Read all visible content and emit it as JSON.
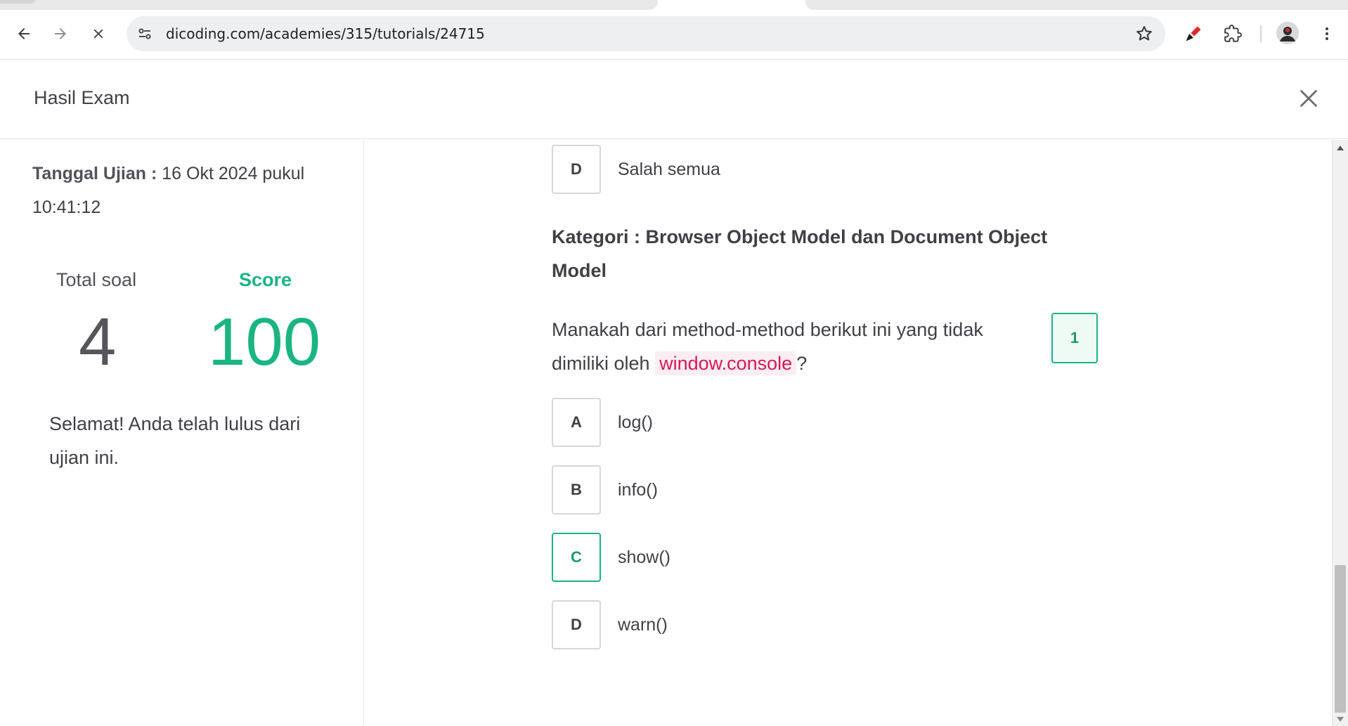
{
  "browser": {
    "url": "dicoding.com/academies/315/tutorials/24715"
  },
  "header": {
    "title": "Hasil Exam"
  },
  "summary": {
    "date_label": "Tanggal Ujian :",
    "date_value": "16 Okt 2024 pukul 10:41:12",
    "total_label": "Total soal",
    "total_value": "4",
    "score_label": "Score",
    "score_value": "100",
    "message": "Selamat! Anda telah lulus dari ujian ini."
  },
  "previous_question": {
    "option": {
      "letter": "D",
      "text": "Salah semua"
    }
  },
  "question": {
    "category": "Kategori : Browser Object Model dan Document Object Model",
    "text_before": "Manakah dari method-method berikut ini yang tidak dimiliki oleh",
    "code": "window.console",
    "text_after": "?",
    "number": "1",
    "options": [
      {
        "letter": "A",
        "text": "log()"
      },
      {
        "letter": "B",
        "text": "info()"
      },
      {
        "letter": "C",
        "text": "show()"
      },
      {
        "letter": "D",
        "text": "warn()"
      }
    ],
    "correct_color": "#1ab580"
  }
}
